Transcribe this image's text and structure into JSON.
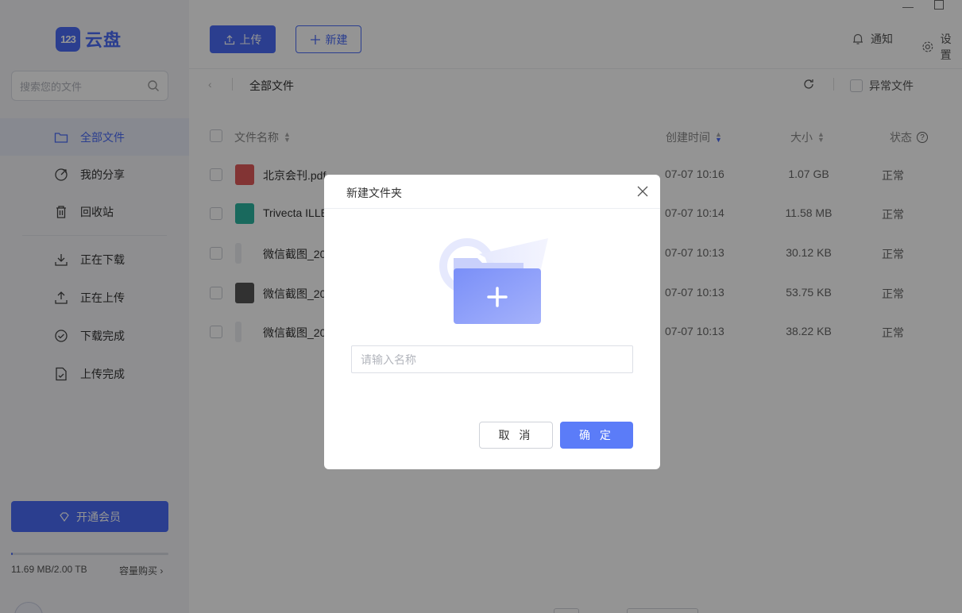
{
  "app": {
    "logo_badge": "123",
    "logo_text": "云盘"
  },
  "sidebar": {
    "search_placeholder": "搜索您的文件",
    "nav_top": [
      {
        "label": "全部文件",
        "icon": "folder-icon",
        "active": true
      },
      {
        "label": "我的分享",
        "icon": "share-icon",
        "active": false
      },
      {
        "label": "回收站",
        "icon": "trash-icon",
        "active": false
      }
    ],
    "nav_transfer": [
      {
        "label": "正在下载",
        "icon": "download-icon"
      },
      {
        "label": "正在上传",
        "icon": "upload-icon"
      },
      {
        "label": "下载完成",
        "icon": "download-done-icon"
      },
      {
        "label": "上传完成",
        "icon": "upload-done-icon"
      }
    ],
    "vip_label": "开通会员",
    "quota_text": "11.69 MB/2.00 TB",
    "quota_fraction": 5.7e-06,
    "quota_buy": "容量购买"
  },
  "topbar": {
    "upload_label": "上传",
    "new_label": "新建",
    "notify_label": "通知",
    "settings_label": "设置"
  },
  "breadcrumb": {
    "current": "全部文件",
    "abnormal_label": "异常文件"
  },
  "table": {
    "headers": {
      "name": "文件名称",
      "created": "创建时间",
      "size": "大小",
      "status": "状态"
    },
    "rows": [
      {
        "name": "北京会刊.pdf",
        "date": "07-07 10:16",
        "size": "1.07 GB",
        "status": "正常",
        "icon": "pdf-icon"
      },
      {
        "name": "Trivecta ILLE",
        "date": "07-07 10:14",
        "size": "11.58 MB",
        "status": "正常",
        "icon": "audio-icon"
      },
      {
        "name": "微信截图_20",
        "date": "07-07 10:13",
        "size": "30.12 KB",
        "status": "正常",
        "icon": "image-thumb-icon"
      },
      {
        "name": "微信截图_20",
        "date": "07-07 10:13",
        "size": "53.75 KB",
        "status": "正常",
        "icon": "image-thumb-icon"
      },
      {
        "name": "微信截图_20",
        "date": "07-07 10:13",
        "size": "38.22 KB",
        "status": "正常",
        "icon": "image-thumb-icon"
      }
    ]
  },
  "modal": {
    "title": "新建文件夹",
    "input_placeholder": "请输入名称",
    "cancel_label": "取 消",
    "ok_label": "确 定"
  },
  "colors": {
    "accent": "#4a6cf7",
    "overlay": "rgba(0,0,0,0.42)"
  }
}
